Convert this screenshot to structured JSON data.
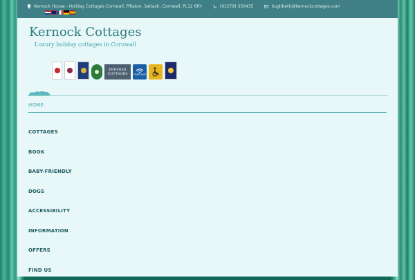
{
  "topbar": {
    "address": "Kernock House - Holiday Cottages Cornwall, Pillaton, Saltash, Cornwall, PL12 6RY",
    "phone": "(01579) 350435",
    "email": "hughbeth@kernockcottages.com",
    "flags": [
      "nl",
      "gb",
      "fr",
      "de",
      "es"
    ]
  },
  "site": {
    "title": "Kernock Cottages",
    "tagline": "Luxury holiday cottages in Cornwall"
  },
  "badges": [
    {
      "name": "visit-england-badge"
    },
    {
      "name": "quality-rosette-badge"
    },
    {
      "name": "gold-award-badge"
    },
    {
      "name": "green-tourism-badge"
    },
    {
      "name": "premier-cottages-badge",
      "label": "PREMIER COTTAGES"
    },
    {
      "name": "free-wifi-badge",
      "label": "FREE WIFI"
    },
    {
      "name": "accessibility-badge"
    },
    {
      "name": "cornwall-tourism-award-badge"
    }
  ],
  "nav": {
    "items": [
      "HOME",
      "COTTAGES",
      "BOOK",
      "BABY-FRIENDLY",
      "DOGS",
      "ACCESSIBILITY",
      "INFORMATION",
      "OFFERS",
      "FIND US"
    ],
    "active_index": 0
  },
  "colors": {
    "topbar": "#3f7f86",
    "panel": "#e8f7f8",
    "accent": "#3aa7b1",
    "nav_text": "#1f5c61"
  }
}
